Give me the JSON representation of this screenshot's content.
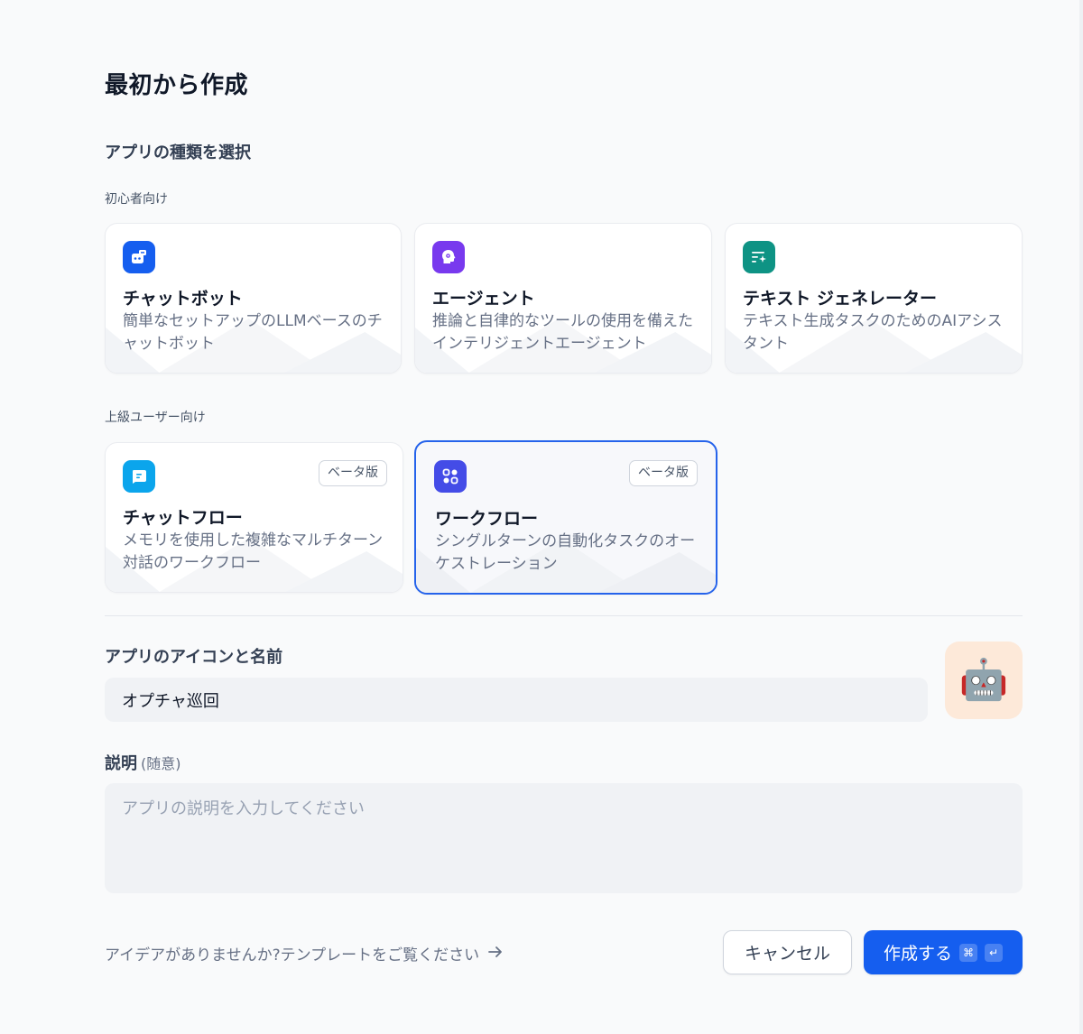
{
  "page_title": "最初から作成",
  "section_title": "アプリの種類を選択",
  "groups": {
    "beginner": "初心者向け",
    "advanced": "上級ユーザー向け"
  },
  "cards": {
    "chatbot": {
      "title": "チャットボット",
      "desc": "簡単なセットアップのLLMベースのチャットボット",
      "icon": "chatbot-icon",
      "color": "#155eef"
    },
    "agent": {
      "title": "エージェント",
      "desc": "推論と自律的なツールの使用を備えたインテリジェントエージェント",
      "icon": "agent-icon",
      "color": "#7839ee"
    },
    "textgen": {
      "title": "テキスト ジェネレーター",
      "desc": "テキスト生成タスクのためのAIアシスタント",
      "icon": "text-generator-icon",
      "color": "#0e9384"
    },
    "chatflow": {
      "title": "チャットフロー",
      "desc": "メモリを使用した複雑なマルチターン対話のワークフロー",
      "badge": "ベータ版",
      "icon": "chatflow-icon",
      "color": "#0ba5ec"
    },
    "workflow": {
      "title": "ワークフロー",
      "desc": "シングルターンの自動化タスクのオーケストレーション",
      "badge": "ベータ版",
      "icon": "workflow-icon",
      "color": "#444ce7"
    }
  },
  "name_section": {
    "label": "アプリのアイコンと名前",
    "value": "オプチャ巡回",
    "avatar": "🤖"
  },
  "description_section": {
    "label": "説明",
    "optional": "(随意)",
    "placeholder": "アプリの説明を入力してください"
  },
  "footer": {
    "template_link": "アイデアがありませんか?テンプレートをご覧ください",
    "cancel": "キャンセル",
    "create": "作成する",
    "shortcut_cmd": "⌘",
    "shortcut_enter": "↵"
  }
}
